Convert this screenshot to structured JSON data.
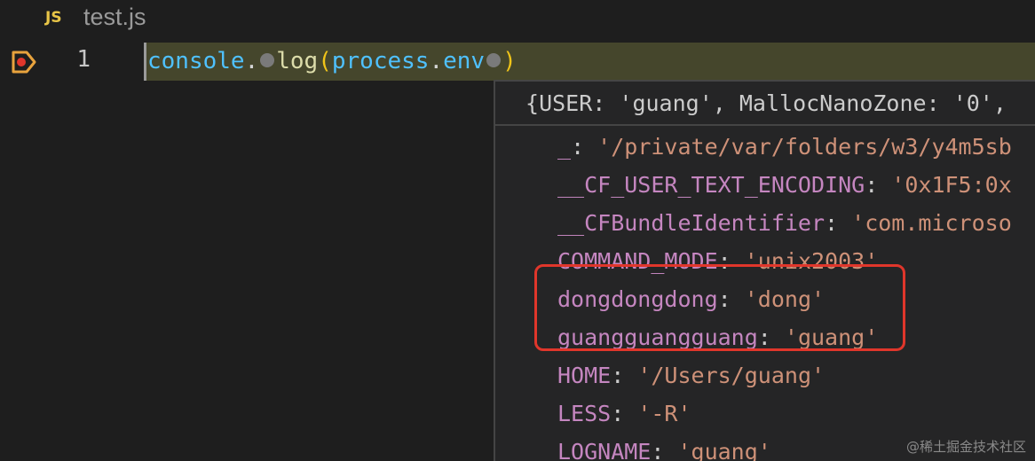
{
  "tab": {
    "icon_label": "JS",
    "file_name": "test.js"
  },
  "editor": {
    "line_number": "1",
    "code": {
      "object": "console",
      "dot": ".",
      "method": "log",
      "open_paren": "(",
      "arg_object": "process",
      "arg_dot": ".",
      "arg_property": "env",
      "close_paren": ")"
    },
    "breakpoint_color": "#e8a33d",
    "line_highlight_color": "#45462c"
  },
  "hover": {
    "summary": {
      "open": "{",
      "key1": "USER",
      "val1": "'guang'",
      "key2": "MallocNanoZone",
      "val2": "'0'",
      "tail": ","
    },
    "properties": [
      {
        "key": "_",
        "value": "'/private/var/folders/w3/y4m5sb"
      },
      {
        "key": "__CF_USER_TEXT_ENCODING",
        "value": "'0x1F5:0x"
      },
      {
        "key": "__CFBundleIdentifier",
        "value": "'com.microso"
      },
      {
        "key": "COMMAND_MODE",
        "value": "'unix2003'"
      },
      {
        "key": "dongdongdong",
        "value": "'dong'"
      },
      {
        "key": "guangguangguang",
        "value": "'guang'"
      },
      {
        "key": "HOME",
        "value": "'/Users/guang'"
      },
      {
        "key": "LESS",
        "value": "'-R'"
      },
      {
        "key": "LOGNAME",
        "value": "'guang'"
      }
    ]
  },
  "watermark": "@稀土掘金技术社区"
}
